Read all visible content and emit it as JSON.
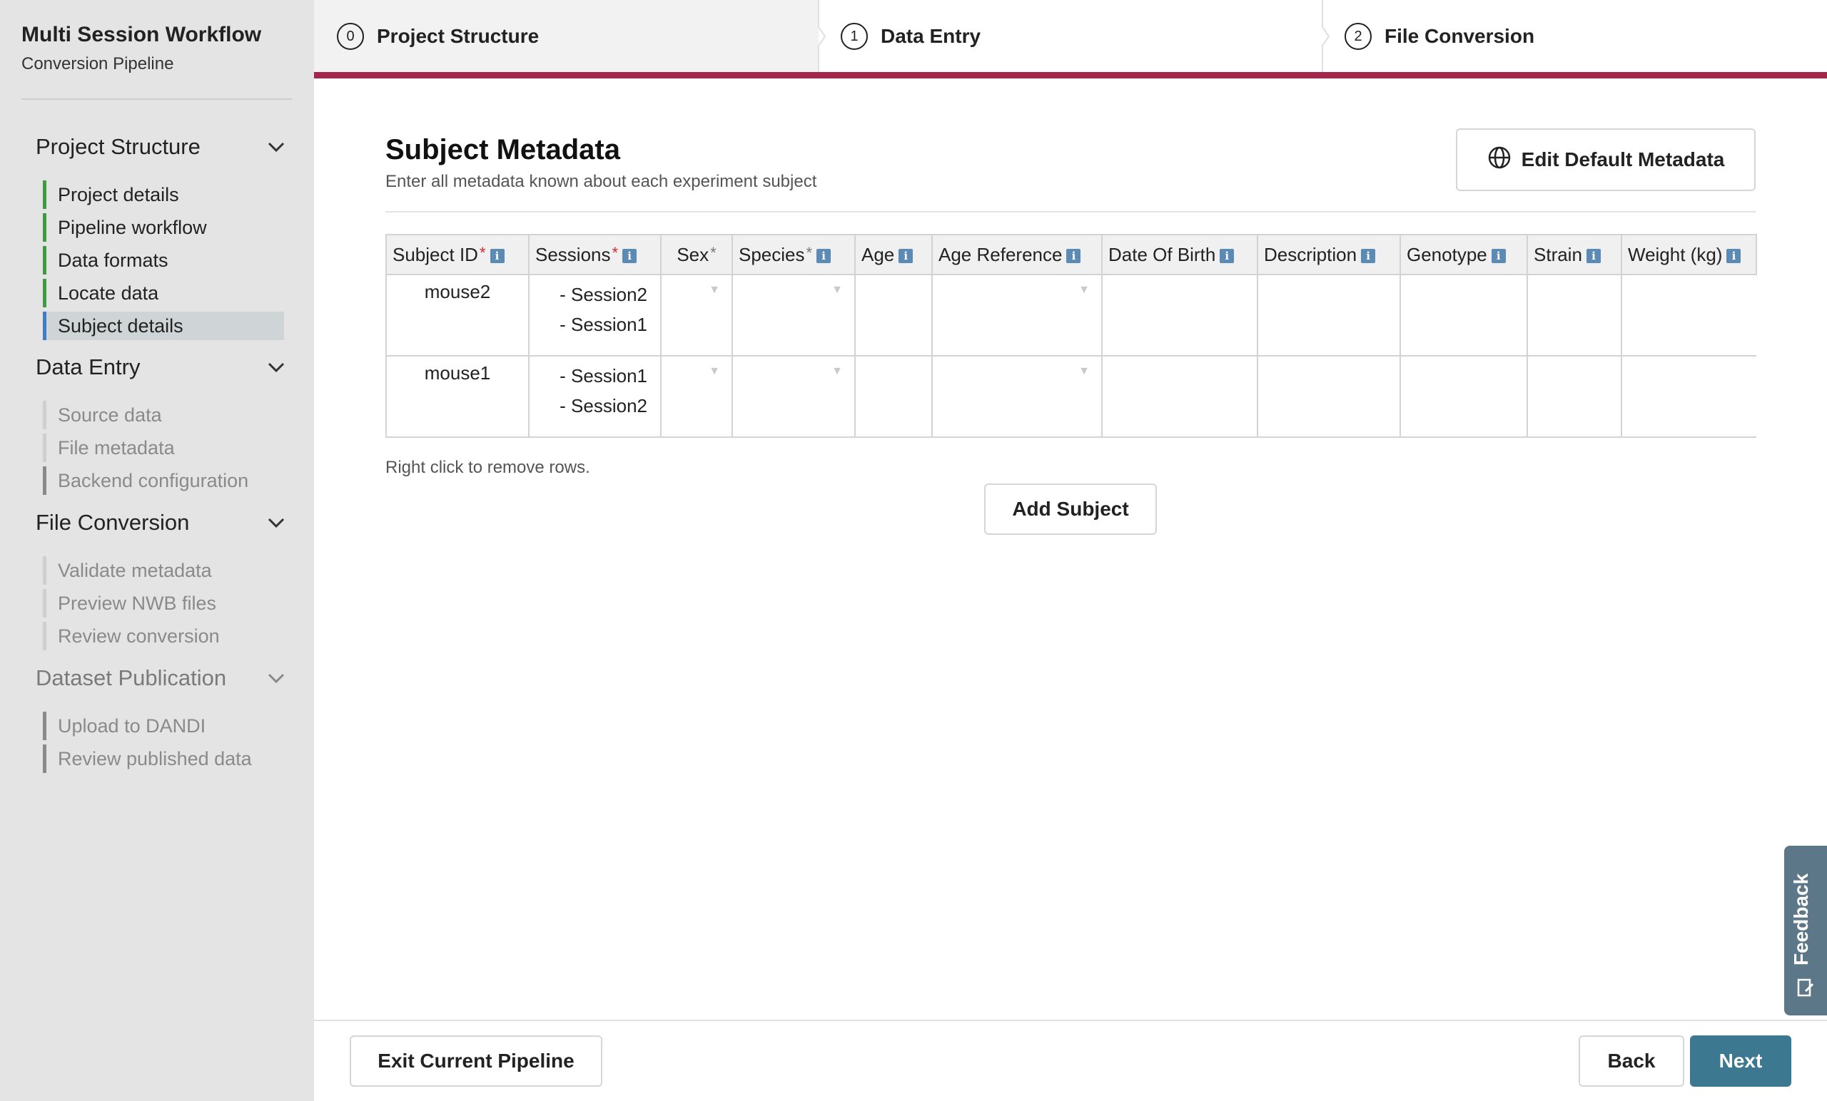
{
  "sidebar": {
    "title": "Multi Session Workflow",
    "subtitle": "Conversion Pipeline",
    "sections": [
      {
        "label": "Project Structure",
        "items": [
          "Project details",
          "Pipeline workflow",
          "Data formats",
          "Locate data",
          "Subject details"
        ]
      },
      {
        "label": "Data Entry",
        "items": [
          "Source data",
          "File metadata",
          "Backend configuration"
        ]
      },
      {
        "label": "File Conversion",
        "items": [
          "Validate metadata",
          "Preview NWB files",
          "Review conversion"
        ]
      },
      {
        "label": "Dataset Publication",
        "items": [
          "Upload to DANDI",
          "Review published data"
        ]
      }
    ]
  },
  "stepper": {
    "steps": [
      {
        "num": "0",
        "label": "Project Structure"
      },
      {
        "num": "1",
        "label": "Data Entry"
      },
      {
        "num": "2",
        "label": "File Conversion"
      }
    ],
    "accent": "#a3264d"
  },
  "main": {
    "title": "Subject Metadata",
    "subtitle": "Enter all metadata known about each experiment subject",
    "edit_default_label": "Edit Default Metadata",
    "table": {
      "columns": [
        "Subject ID",
        "Sessions",
        "Sex",
        "Species",
        "Age",
        "Age Reference",
        "Date Of Birth",
        "Description",
        "Genotype",
        "Strain",
        "Weight (kg)"
      ],
      "rows": [
        {
          "subject_id": "mouse2",
          "sessions": [
            "- Session2",
            "- Session1"
          ]
        },
        {
          "subject_id": "mouse1",
          "sessions": [
            "- Session1",
            "- Session2"
          ]
        }
      ]
    },
    "hint": "Right click to remove rows.",
    "add_subject_label": "Add Subject"
  },
  "feedback_label": "Feedback",
  "footer": {
    "exit_label": "Exit Current Pipeline",
    "back_label": "Back",
    "next_label": "Next"
  },
  "colors": {
    "next_button": "#3d7891",
    "done_marker": "#3f9b3f",
    "current_marker": "#3d7ec7",
    "required": "#d9262e"
  }
}
